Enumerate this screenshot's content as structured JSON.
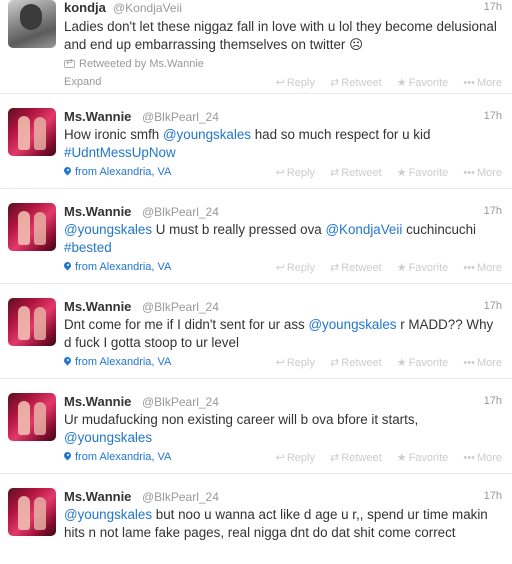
{
  "actions": {
    "reply": "Reply",
    "retweet": "Retweet",
    "favorite": "Favorite",
    "more": "More",
    "expand": "Expand"
  },
  "tweets": [
    {
      "fullname": "kondja",
      "username": "@KondjaVeii",
      "time": "17h",
      "text": "Ladies don't let these niggaz fall in love with u lol they become delusional and end up embarrassing themselves on twitter ☹",
      "retweeted_by": "Retweeted by Ms.Wannie"
    },
    {
      "fullname": "Ms.Wannie",
      "username": "@BlkPearl_24",
      "time": "17h",
      "text_parts": [
        "How ironic smfh ",
        "@youngskales",
        "  had so much respect for u kid ",
        "#UdntMessUpNow"
      ],
      "place": "from Alexandria, VA"
    },
    {
      "fullname": "Ms.Wannie",
      "username": "@BlkPearl_24",
      "time": "17h",
      "text_parts": [
        "@youngskales",
        " U must b really pressed ova ",
        "@KondjaVeii",
        " cuchincuchi ",
        "#bested"
      ],
      "place": "from Alexandria, VA"
    },
    {
      "fullname": "Ms.Wannie",
      "username": "@BlkPearl_24",
      "time": "17h",
      "text_parts": [
        "Dnt come for me if I didn't sent for ur ass ",
        "@youngskales",
        " r MADD?? Why d fuck I gotta stoop to ur level"
      ],
      "place": "from Alexandria, VA"
    },
    {
      "fullname": "Ms.Wannie",
      "username": "@BlkPearl_24",
      "time": "17h",
      "text_parts": [
        "Ur mudafucking non existing career will b ova bfore it starts, ",
        "@youngskales"
      ],
      "place": "from Alexandria, VA"
    },
    {
      "fullname": "Ms.Wannie",
      "username": "@BlkPearl_24",
      "time": "17h",
      "text_parts": [
        "@youngskales",
        " but noo u wanna act like d age u r,, spend ur time makin hits n not lame fake pages, real nigga dnt do dat shit come correct"
      ]
    }
  ]
}
